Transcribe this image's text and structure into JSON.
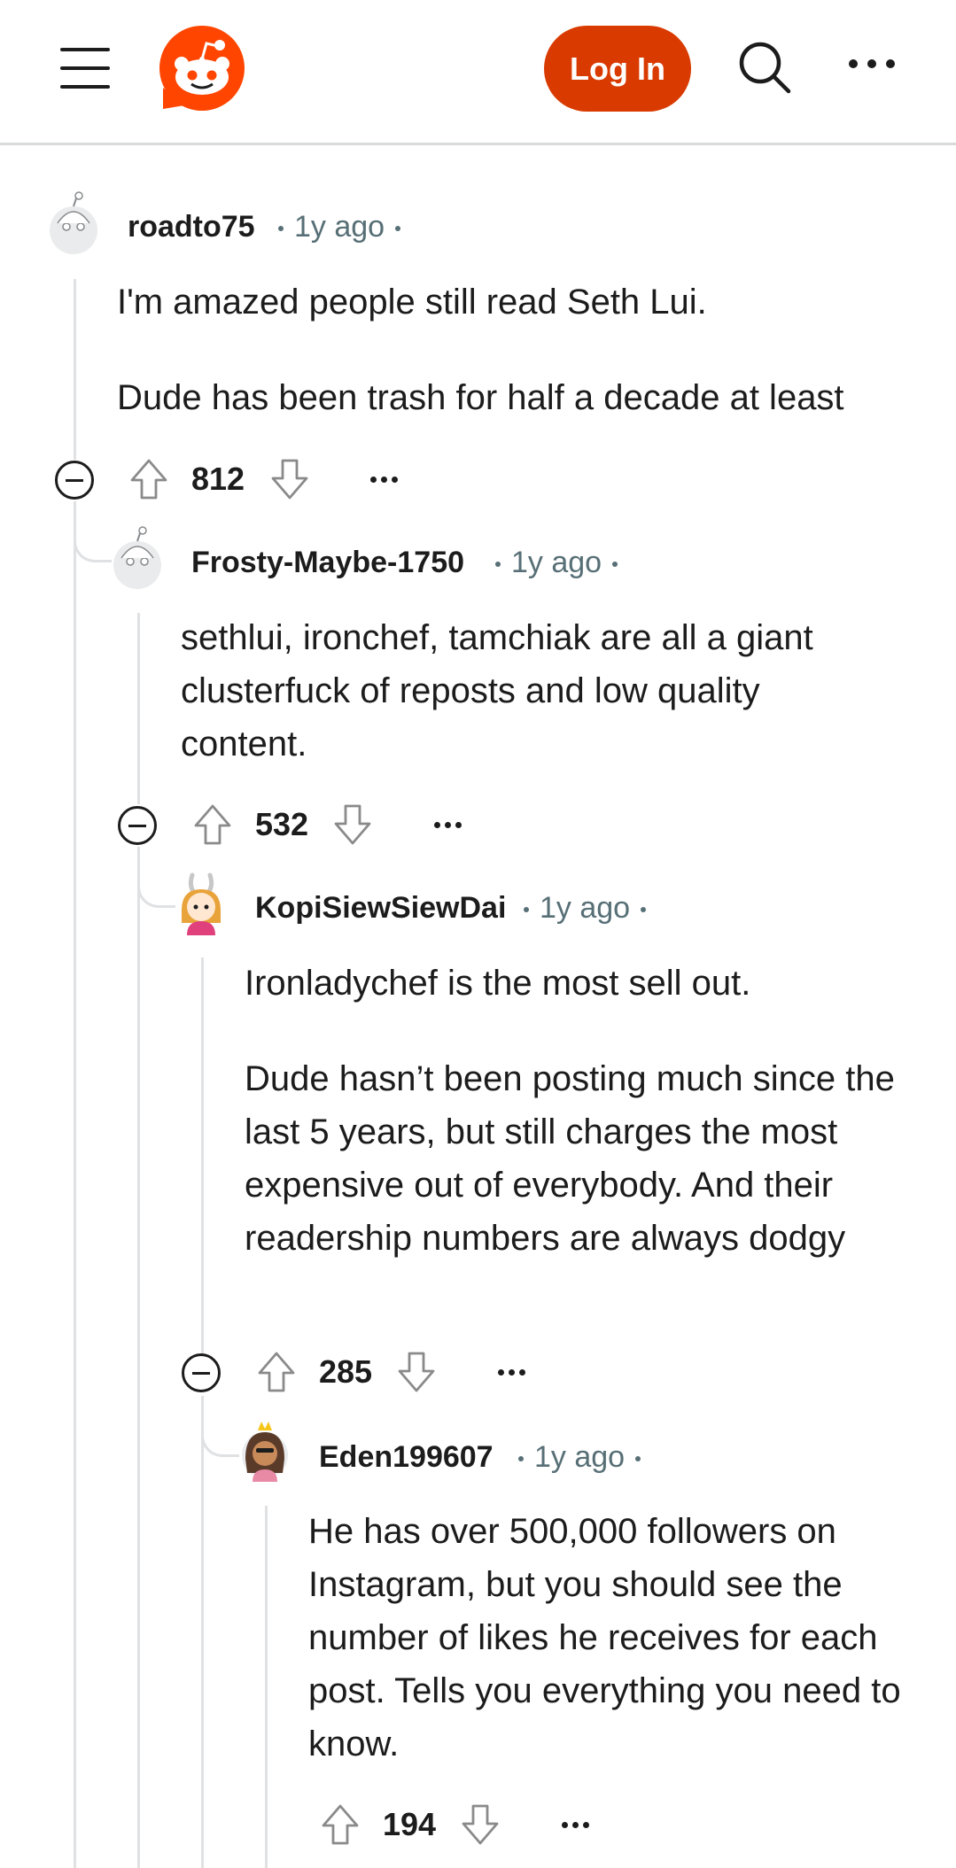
{
  "header": {
    "login_label": "Log In",
    "icons": [
      "menu-icon",
      "reddit-logo",
      "search-icon",
      "more-icon"
    ],
    "colors": {
      "accent": "#d93a00",
      "logo": "#ff4500"
    }
  },
  "comments": [
    {
      "username": "roadto75",
      "time": "1y ago",
      "paragraphs": [
        "I'm amazed people still read Seth Lui.",
        "Dude has been trash for half a decade at least"
      ],
      "score": "812"
    },
    {
      "username": "Frosty-Maybe-1750",
      "time": "1y ago",
      "paragraphs": [
        "sethlui, ironchef, tamchiak are all a giant clusterfuck of reposts and low quality content."
      ],
      "score": "532"
    },
    {
      "username": "KopiSiewSiewDai",
      "time": "1y ago",
      "paragraphs": [
        "Ironladychef is the most sell out.",
        "Dude hasn’t been posting much since the last 5 years, but still charges the most expensive out of everybody. And their readership numbers are always dodgy"
      ],
      "score": "285"
    },
    {
      "username": "Eden199607",
      "time": "1y ago",
      "paragraphs": [
        "He has over 500,000 followers on Instagram, but you should see the number of likes he receives for each post. Tells you everything you need to know."
      ],
      "score": "194"
    }
  ]
}
